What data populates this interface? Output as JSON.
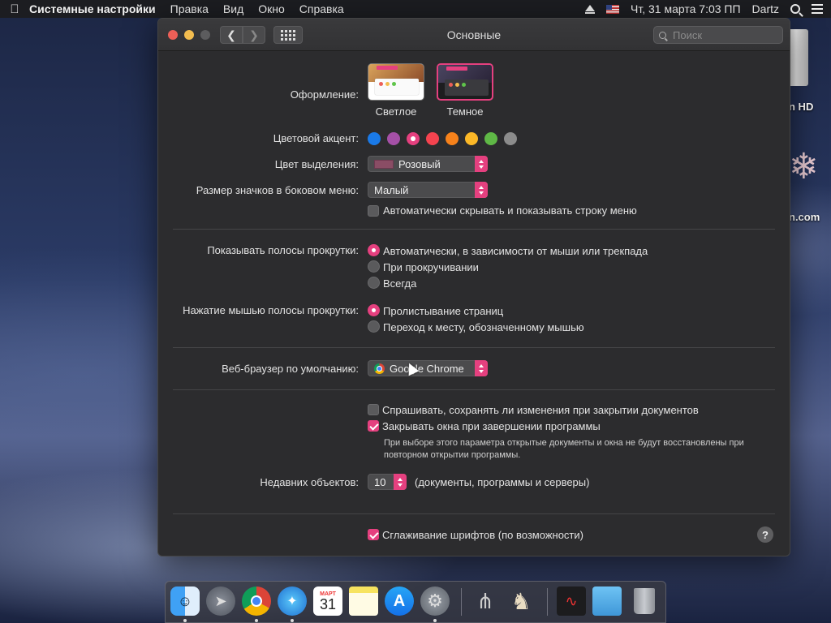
{
  "menubar": {
    "apple": "",
    "app": "Системные настройки",
    "items": [
      "Правка",
      "Вид",
      "Окно",
      "Справка"
    ],
    "datetime": "Чт, 31 марта  7:03 ПП",
    "user": "Dartz"
  },
  "desktop": {
    "label1": "n HD",
    "label2": "n.com"
  },
  "window": {
    "title": "Основные",
    "search_placeholder": "Поиск",
    "appearance": {
      "label": "Оформление:",
      "light": "Светлое",
      "dark": "Темное"
    },
    "accent": {
      "label": "Цветовой акцент:",
      "colors": [
        "#1a7ae8",
        "#a550a7",
        "#e5407f",
        "#f5434f",
        "#f7821b",
        "#fcb827",
        "#5fb846",
        "#8c8c8c"
      ],
      "selected_index": 2
    },
    "highlight": {
      "label": "Цвет выделения:",
      "value": "Розовый"
    },
    "sidebar_icon": {
      "label": "Размер значков в боковом меню:",
      "value": "Малый"
    },
    "autohide_menu": {
      "label": "Автоматически скрывать и показывать строку меню",
      "checked": false
    },
    "scrollbars": {
      "label": "Показывать полосы прокрутки:",
      "options": [
        "Автоматически, в зависимости от мыши или трекпада",
        "При прокручивании",
        "Всегда"
      ],
      "selected_index": 0
    },
    "scroll_click": {
      "label": "Нажатие мышью полосы прокрутки:",
      "options": [
        "Пролистывание страниц",
        "Переход к месту, обозначенному мышью"
      ],
      "selected_index": 0
    },
    "browser": {
      "label": "Веб-браузер по умолчанию:",
      "value": "Google Chrome"
    },
    "ask_save": {
      "label": "Спрашивать, сохранять ли изменения при закрытии документов",
      "checked": false
    },
    "close_windows": {
      "label": "Закрывать окна при завершении программы",
      "checked": true,
      "note": "При выборе этого параметра открытые документы и окна не будут восстановлены при повторном открытии программы."
    },
    "recent": {
      "label": "Недавних объектов:",
      "value": "10",
      "suffix": "(документы, программы и серверы)"
    },
    "font_smoothing": {
      "label": "Сглаживание шрифтов (по возможности)",
      "checked": true
    },
    "help": "?"
  },
  "dock": {
    "calendar_month": "МАРТ",
    "calendar_day": "31"
  }
}
